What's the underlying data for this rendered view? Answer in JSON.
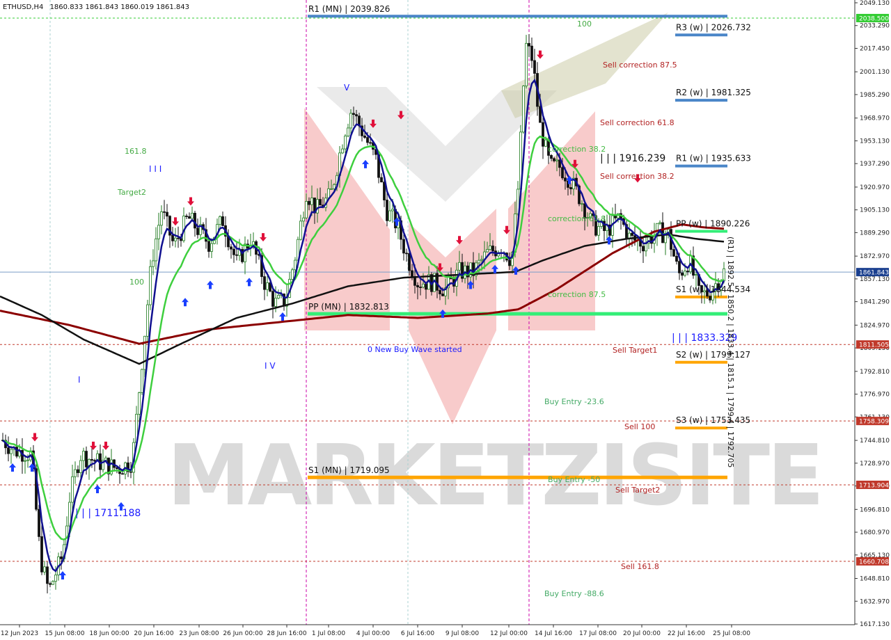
{
  "header": {
    "symbol": "ETHUSD,H4",
    "ohlc": "1860.833 1861.843 1860.019 1861.843"
  },
  "chart_data": {
    "type": "candlestick",
    "title": "",
    "ylim": [
      1609.5,
      2051.5
    ],
    "y_ticks": [
      2049.13,
      2033.29,
      2017.45,
      2001.13,
      1985.29,
      1968.97,
      1953.13,
      1937.29,
      1920.97,
      1905.13,
      1889.29,
      1872.97,
      1857.13,
      1841.29,
      1824.97,
      1809.13,
      1792.81,
      1776.97,
      1761.13,
      1744.81,
      1728.97,
      1713.13,
      1696.81,
      1680.97,
      1665.13,
      1648.81,
      1632.97,
      1617.13
    ],
    "x_ticks": [
      "12 Jun 2023",
      "15 Jun 08:00",
      "18 Jun 00:00",
      "20 Jun 16:00",
      "23 Jun 08:00",
      "26 Jun 00:00",
      "28 Jun 16:00",
      "1 Jul 08:00",
      "4 Jul 00:00",
      "6 Jul 16:00",
      "9 Jul 08:00",
      "12 Jul 00:00",
      "14 Jul 16:00",
      "17 Jul 08:00",
      "20 Jul 00:00",
      "22 Jul 16:00",
      "25 Jul 08:00"
    ],
    "current_price": {
      "value": 1861.843,
      "label": "1861.843",
      "color": "#1a3f8f"
    },
    "boxed_levels": [
      {
        "value": 2038.5,
        "label": "2038.500",
        "color": "#33cc33"
      },
      {
        "value": 1811.505,
        "label": "1811.505",
        "color": "#c0392b"
      },
      {
        "value": 1758.309,
        "label": "1758.309",
        "color": "#c0392b"
      },
      {
        "value": 1713.904,
        "label": "1713.904",
        "color": "#c0392b"
      },
      {
        "value": 1660.708,
        "label": "1660.708",
        "color": "#c0392b"
      }
    ],
    "monthly_pivots": [
      {
        "label": "R1 (MN) | 2039.826",
        "value": 2039.826,
        "color": "#4a86c8"
      },
      {
        "label": "PP (MN) | 1832.813",
        "value": 1832.813,
        "color": "#33ee77"
      },
      {
        "label": "S1 (MN) | 1719.095",
        "value": 1719.095,
        "color": "#ffa500"
      }
    ],
    "weekly_pivots": [
      {
        "label": "R3 (w) | 2026.732",
        "value": 2026.732,
        "color": "#4a86c8"
      },
      {
        "label": "R2 (w) | 1981.325",
        "value": 1981.325,
        "color": "#4a86c8"
      },
      {
        "label": "R1 (w) | 1935.633",
        "value": 1935.633,
        "color": "#4a86c8"
      },
      {
        "label": "PP (w) | 1890.226",
        "value": 1890.226,
        "color": "#33ee77"
      },
      {
        "label": "S1 (w) | 1844.534",
        "value": 1844.534,
        "color": "#ffa500"
      },
      {
        "label": "S2 (w) | 1799.127",
        "value": 1799.127,
        "color": "#ffa500"
      },
      {
        "label": "S3 (w) | 1753.435",
        "value": 1753.435,
        "color": "#ffa500"
      }
    ],
    "annotations": [
      {
        "text": "Sell correction 87.5",
        "color": "#b22222"
      },
      {
        "text": "Sell correction 61.8",
        "color": "#b22222"
      },
      {
        "text": "Sell correction 38.2",
        "color": "#b22222"
      },
      {
        "text": "correction 38.2",
        "color": "#44bb44"
      },
      {
        "text": "correction 61.8",
        "color": "#44bb44"
      },
      {
        "text": "correction 87.5",
        "color": "#44bb44"
      },
      {
        "text": "| | | 1916.239",
        "color": "#111111"
      },
      {
        "text": "| | | 1833.329",
        "color": "#1a1aff"
      },
      {
        "text": "| | | 1711.188",
        "color": "#1a1aff"
      },
      {
        "text": "0 New Buy Wave started",
        "color": "#1a1aff"
      },
      {
        "text": "Sell Target1",
        "color": "#b22222"
      },
      {
        "text": "Sell 100",
        "color": "#b22222"
      },
      {
        "text": "Sell Target2",
        "color": "#b22222"
      },
      {
        "text": "Sell 161.8",
        "color": "#b22222"
      },
      {
        "text": "Buy Entry -23.6",
        "color": "#44aa66"
      },
      {
        "text": "Buy Entry -50",
        "color": "#44aa66"
      },
      {
        "text": "Buy Entry -88.6",
        "color": "#44aa66"
      },
      {
        "text": "161.8",
        "color": "#44aa44"
      },
      {
        "text": "Target2",
        "color": "#44aa44"
      },
      {
        "text": "100",
        "color": "#44aa44"
      },
      {
        "text": "100",
        "color": "#44aa44"
      },
      {
        "text": "I I I",
        "color": "#1a1aff"
      },
      {
        "text": "I V",
        "color": "#1a1aff"
      },
      {
        "text": "I",
        "color": "#1a1aff"
      },
      {
        "text": "V",
        "color": "#1a1aff"
      }
    ],
    "watermark": "MARKETZISITE",
    "colors": {
      "bull": "#1f7a1f",
      "bear": "#111111",
      "ma_blue": "#101090",
      "ma_green": "#3ecf3e",
      "ma_black": "#111111",
      "ma_maroon": "#8b0000"
    }
  }
}
